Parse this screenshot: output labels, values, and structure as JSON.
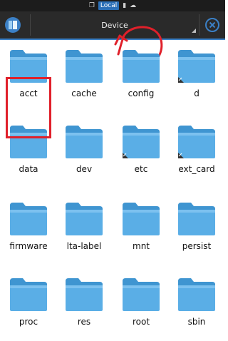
{
  "status_bar": {
    "local_label": "Local"
  },
  "toolbar": {
    "title": "Device"
  },
  "colors": {
    "folder": "#5aaee6",
    "folder_dark": "#3f95d1",
    "accent": "#3b80c6",
    "annotation": "#e0202a"
  },
  "folders": [
    {
      "label": "acct",
      "link": false
    },
    {
      "label": "cache",
      "link": false
    },
    {
      "label": "config",
      "link": false
    },
    {
      "label": "d",
      "link": true
    },
    {
      "label": "data",
      "link": false,
      "highlighted": true
    },
    {
      "label": "dev",
      "link": false
    },
    {
      "label": "etc",
      "link": true
    },
    {
      "label": "ext_card",
      "link": true
    },
    {
      "label": "firmware",
      "link": false
    },
    {
      "label": "lta-label",
      "link": false
    },
    {
      "label": "mnt",
      "link": false
    },
    {
      "label": "persist",
      "link": false
    },
    {
      "label": "proc",
      "link": false
    },
    {
      "label": "res",
      "link": false
    },
    {
      "label": "root",
      "link": false
    },
    {
      "label": "sbin",
      "link": false
    }
  ]
}
